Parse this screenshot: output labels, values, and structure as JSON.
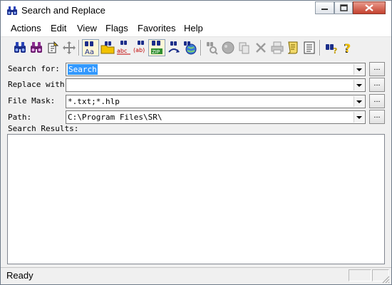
{
  "window": {
    "title": "Search and Replace"
  },
  "menu": [
    "Actions",
    "Edit",
    "View",
    "Flags",
    "Favorites",
    "Help"
  ],
  "toolbar": {
    "buttons": [
      {
        "icon": "binoculars-search-icon"
      },
      {
        "icon": "binoculars-replace-icon"
      },
      {
        "icon": "open-file-icon"
      },
      {
        "icon": "move-icon"
      },
      {
        "icon": "match-case-icon",
        "pressed": true
      },
      {
        "icon": "search-folder-icon"
      },
      {
        "icon": "abc-replace-icon"
      },
      {
        "icon": "ab-brackets-icon"
      },
      {
        "icon": "zip-search-icon",
        "pressed": true
      },
      {
        "icon": "replace-arrows-icon"
      },
      {
        "icon": "web-search-icon"
      },
      {
        "icon": "magnifier-find-icon",
        "disabled": true
      },
      {
        "icon": "stop-icon",
        "disabled": true
      },
      {
        "icon": "copy-icon",
        "disabled": true
      },
      {
        "icon": "delete-icon",
        "disabled": true
      },
      {
        "icon": "print-icon",
        "disabled": true
      },
      {
        "icon": "script-icon"
      },
      {
        "icon": "list-icon"
      },
      {
        "icon": "help-binoculars-icon"
      },
      {
        "icon": "help-question-icon"
      }
    ]
  },
  "form": {
    "search_label": "Search for:",
    "search_value": "Search",
    "replace_label": "Replace with:",
    "replace_value": "",
    "filemask_label": "File Mask:",
    "filemask_value": "*.txt;*.hlp",
    "path_label": "Path:",
    "path_value": "C:\\Program Files\\SR\\",
    "browse_label": "..."
  },
  "results": {
    "label": "Search Results:"
  },
  "status": {
    "text": "Ready"
  }
}
